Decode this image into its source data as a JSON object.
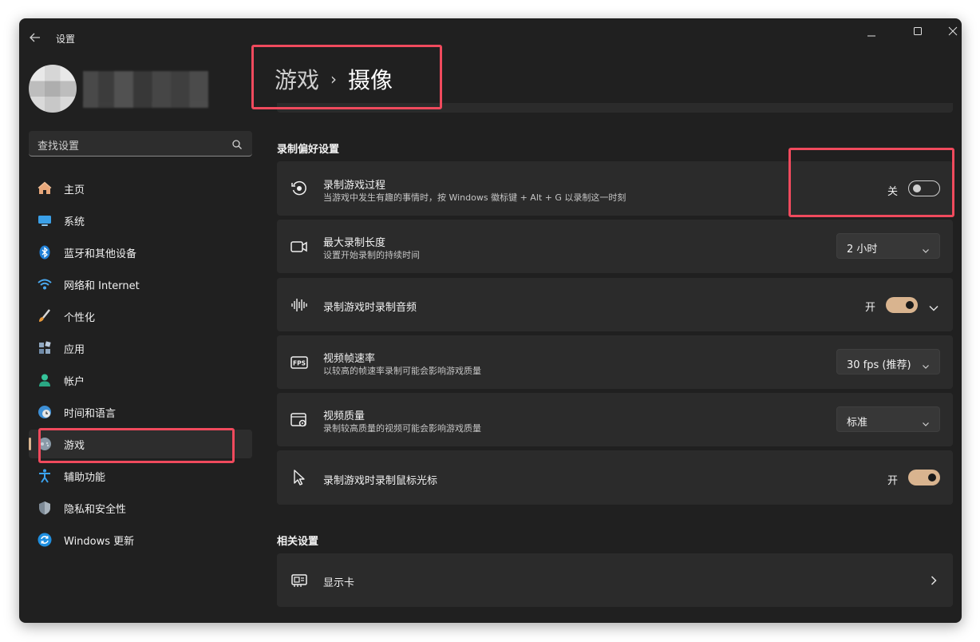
{
  "window": {
    "title": "设置"
  },
  "search": {
    "placeholder": "查找设置"
  },
  "nav": {
    "items": [
      {
        "label": "主页",
        "icon": "home-icon"
      },
      {
        "label": "系统",
        "icon": "monitor-icon"
      },
      {
        "label": "蓝牙和其他设备",
        "icon": "bluetooth-icon"
      },
      {
        "label": "网络和 Internet",
        "icon": "wifi-icon"
      },
      {
        "label": "个性化",
        "icon": "brush-icon"
      },
      {
        "label": "应用",
        "icon": "apps-icon"
      },
      {
        "label": "帐户",
        "icon": "account-icon"
      },
      {
        "label": "时间和语言",
        "icon": "globe-clock-icon"
      },
      {
        "label": "游戏",
        "icon": "gamepad-icon",
        "active": true
      },
      {
        "label": "辅助功能",
        "icon": "accessibility-icon"
      },
      {
        "label": "隐私和安全性",
        "icon": "shield-icon"
      },
      {
        "label": "Windows 更新",
        "icon": "update-icon"
      }
    ]
  },
  "breadcrumb": {
    "parent": "游戏",
    "separator": "›",
    "current": "摄像"
  },
  "sections": {
    "recording_prefs": "录制偏好设置",
    "related": "相关设置"
  },
  "settings": {
    "record_gameplay": {
      "title": "录制游戏过程",
      "desc": "当游戏中发生有趣的事情时，按 Windows 徽标键 + Alt + G 以录制这一时刻",
      "state_label": "关",
      "on": false
    },
    "max_length": {
      "title": "最大录制长度",
      "desc": "设置开始录制的持续时间",
      "value": "2 小时"
    },
    "record_audio": {
      "title": "录制游戏时录制音频",
      "state_label": "开",
      "on": true
    },
    "frame_rate": {
      "title": "视频帧速率",
      "desc": "以较高的帧速率录制可能会影响游戏质量",
      "value": "30 fps (推荐)"
    },
    "video_quality": {
      "title": "视频质量",
      "desc": "录制较高质量的视频可能会影响游戏质量",
      "value": "标准"
    },
    "record_cursor": {
      "title": "录制游戏时录制鼠标光标",
      "state_label": "开",
      "on": true
    },
    "graphics_card": {
      "title": "显示卡"
    }
  },
  "colors": {
    "accent": "#d9b48f",
    "window_bg": "#202020",
    "card_bg": "#2b2b2b",
    "highlight": "#f04a5d"
  }
}
